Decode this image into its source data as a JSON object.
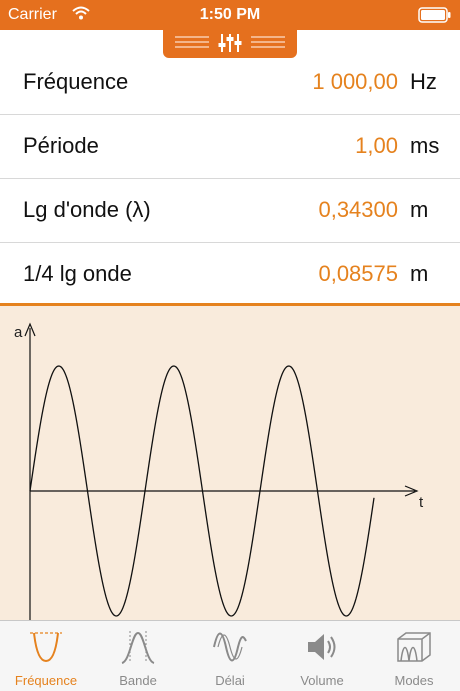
{
  "status_bar": {
    "carrier": "Carrier",
    "time": "1:50 PM"
  },
  "colors": {
    "accent": "#E5701E",
    "value": "#E5821E",
    "graph_bg": "#F9EBDC",
    "tab_inactive": "#8a8a8a"
  },
  "rows": [
    {
      "label": "Fréquence",
      "value": "1 000,00",
      "unit": "Hz"
    },
    {
      "label": "Période",
      "value": "1,00",
      "unit": "ms"
    },
    {
      "label": "Lg d'onde (λ)",
      "value": "0,34300",
      "unit": "m"
    },
    {
      "label": "1/4 lg onde",
      "value": "0,08575",
      "unit": "m"
    }
  ],
  "graph": {
    "y_axis_label": "a",
    "x_axis_label": "t"
  },
  "tabs": [
    {
      "label": "Fréquence",
      "icon": "sine-frequency-icon",
      "active": true
    },
    {
      "label": "Bande",
      "icon": "bandwidth-icon",
      "active": false
    },
    {
      "label": "Délai",
      "icon": "delay-waves-icon",
      "active": false
    },
    {
      "label": "Volume",
      "icon": "speaker-volume-icon",
      "active": false
    },
    {
      "label": "Modes",
      "icon": "room-modes-icon",
      "active": false
    }
  ]
}
